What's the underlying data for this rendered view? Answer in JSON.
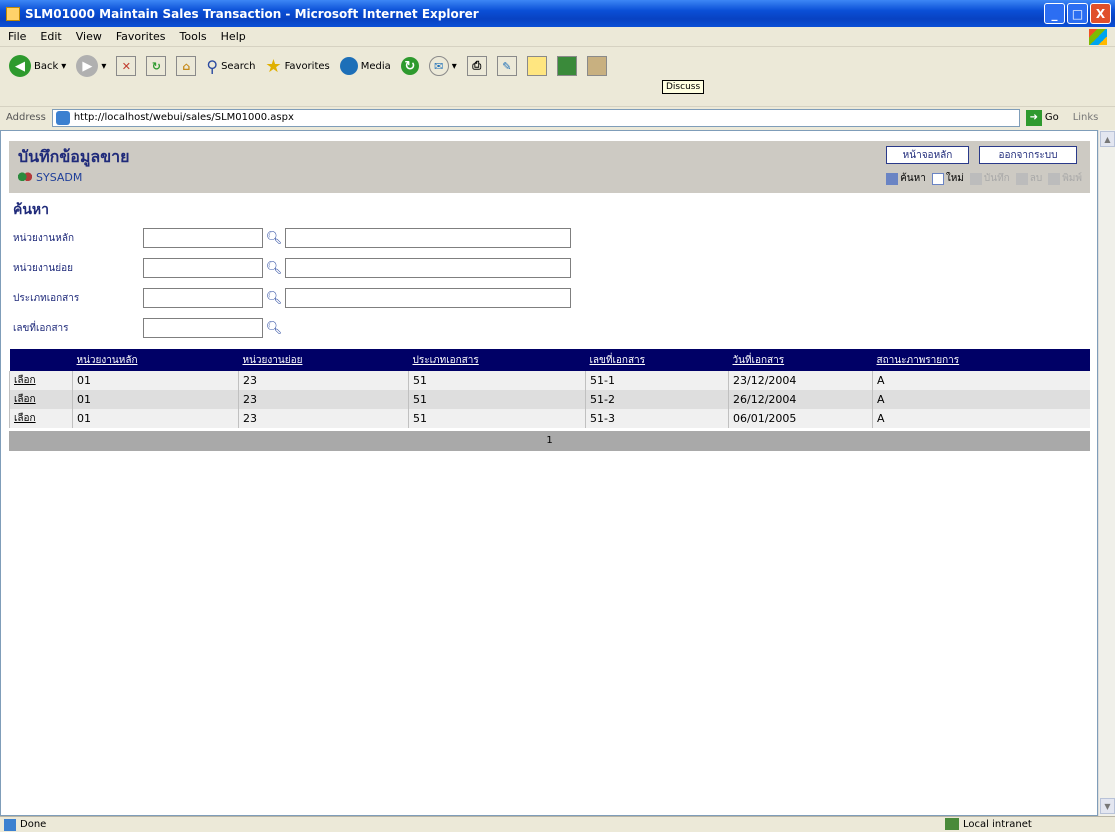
{
  "window": {
    "title": "SLM01000 Maintain Sales Transaction - Microsoft Internet Explorer",
    "buttons": [
      "_",
      "□",
      "X"
    ]
  },
  "menu": [
    "File",
    "Edit",
    "View",
    "Favorites",
    "Tools",
    "Help"
  ],
  "toolbar": {
    "back": "Back",
    "search": "Search",
    "favorites": "Favorites",
    "media": "Media",
    "tooltip": "Discuss"
  },
  "address": {
    "label": "Address",
    "url": "http://localhost/webui/sales/SLM01000.aspx",
    "go": "Go",
    "links": "Links"
  },
  "header": {
    "title": "บันทึกข้อมูลขาย",
    "user": "SYSADM",
    "main_page_button": "หน้าจอหลัก",
    "logout_button": "ออกจากระบบ",
    "tools": [
      "ค้นหา",
      "ใหม่",
      "บันทึก",
      "ลบ",
      "พิมพ์"
    ]
  },
  "search": {
    "heading": "ค้นหา",
    "fields": [
      {
        "label": "หน่วยงานหลัก"
      },
      {
        "label": "หน่วยงานย่อย"
      },
      {
        "label": "ประเภทเอกสาร"
      },
      {
        "label": "เลขที่เอกสาร"
      }
    ]
  },
  "grid": {
    "columns": [
      "หน่วยงานหลัก",
      "หน่วยงานย่อย",
      "ประเภทเอกสาร",
      "เลขที่เอกสาร",
      "วันที่เอกสาร",
      "สถานะภาพรายการ"
    ],
    "rows": [
      {
        "select": "เลือก",
        "main": "01",
        "sub": "23",
        "type": "51",
        "no": "51-1",
        "date": "23/12/2004",
        "status": "A"
      },
      {
        "select": "เลือก",
        "main": "01",
        "sub": "23",
        "type": "51",
        "no": "51-2",
        "date": "26/12/2004",
        "status": "A"
      },
      {
        "select": "เลือก",
        "main": "01",
        "sub": "23",
        "type": "51",
        "no": "51-3",
        "date": "06/01/2005",
        "status": "A"
      }
    ],
    "page": "1"
  },
  "status": {
    "left": "Done",
    "zone": "Local intranet"
  },
  "colors": {
    "title_blue": "#0a4fd6",
    "grid_header": "#000066",
    "header_panel": "#cdcac3",
    "pager": "#a9a9a9"
  }
}
